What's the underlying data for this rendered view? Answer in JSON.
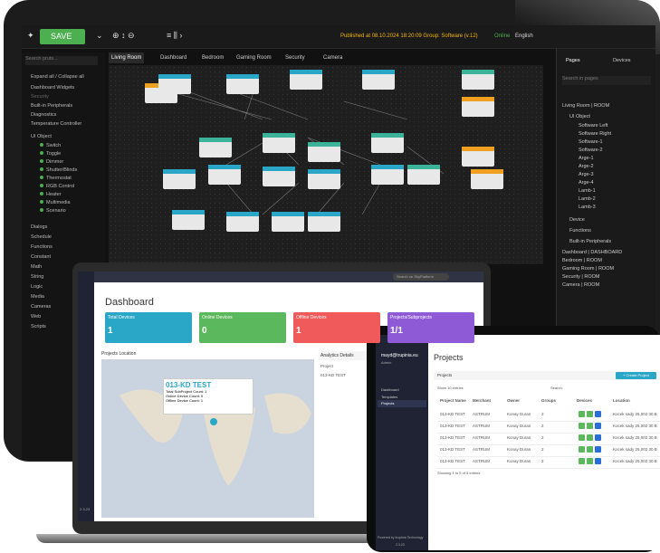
{
  "editor": {
    "save_label": "SAVE",
    "published": "Published at 08.10.2024 18:20:09",
    "group": "Group: Software (v.12)",
    "status": "Online",
    "language": "English",
    "search_placeholder": "Search pruts...",
    "tabs": [
      "Living Room",
      "Dashboard",
      "Bedroom",
      "Gaming Room",
      "Security",
      "Camera"
    ],
    "expand_label": "Expand all",
    "collapse_label": "Collapse all",
    "nav": [
      "Dashboard Widgets",
      "Security",
      "Built-in Peripherals",
      "Diagnostics",
      "Temperature Controller",
      "UI Object"
    ],
    "ui_objects": [
      "Switch",
      "Toggle",
      "Dimmer",
      "Shutter/Blinds",
      "Thermostat",
      "RGB Control",
      "Heater",
      "Multimedia",
      "Scenario"
    ],
    "nav_bottom": [
      "Dialogs",
      "Schedule",
      "Functions",
      "Constant",
      "Math",
      "String",
      "Logic",
      "Media",
      "Cameras",
      "Web",
      "Scripts"
    ],
    "right_tabs": [
      "Pages",
      "Devices"
    ],
    "right_search": "Search in pages",
    "right_tree_root": "Living Room | ROOM",
    "right_tree_ui": "UI Object",
    "right_tree_items": [
      "Software Left",
      "Software Right",
      "Software-1",
      "Software-2",
      "Arge-1",
      "Arge-2",
      "Arge-3",
      "Arge-4",
      "Lamb-1",
      "Lamb-2",
      "Lamb-3"
    ],
    "right_tree_groups": [
      "Device",
      "Functions",
      "Built-in Peripherals"
    ],
    "right_pages": [
      "Dashboard | DASHBOARD",
      "Bedroom | ROOM",
      "Gaming Room | ROOM",
      "Security | ROOM",
      "Camera | ROOM"
    ]
  },
  "laptop": {
    "title": "Dashboard",
    "search_placeholder": "Search on SkyPlatform",
    "cards": [
      {
        "label": "Total Devices",
        "value": "1",
        "color": "#2aa6c7"
      },
      {
        "label": "Online Devices",
        "value": "0",
        "color": "#5cb85c"
      },
      {
        "label": "Offline Devices",
        "value": "1",
        "color": "#f05a5a"
      },
      {
        "label": "Projects/Subprojects",
        "value": "1/1",
        "color": "#8e5ad6"
      }
    ],
    "map_title": "Projects Location",
    "analytics_title": "Analytics Details",
    "analytics_col": "Project",
    "analytics_row": "013-KD TEST",
    "popup_project": "013-KD TEST",
    "popup_lines": [
      "Total SubProject Count: 1",
      "Online Device Count: 0",
      "Offline Device Count: 1"
    ],
    "version": "2.3.23"
  },
  "tablet": {
    "user": "mayd@trupinia.eu",
    "role": "Admin",
    "page_title": "Projects",
    "panel_title": "Projects",
    "create_label": "+ Create Project",
    "show_label": "Show  10  entries",
    "search_label": "Search:",
    "columns": [
      "Project Name",
      "Merchant",
      "Owner",
      "Groups",
      "Devices",
      "Location"
    ],
    "rows": [
      [
        "013-KD TEST",
        "ASTRUM",
        "Konay Duran",
        "2",
        "",
        "Kocek sady 25,002 30 B"
      ],
      [
        "013-KD TEST",
        "ASTRUM",
        "Konay Duran",
        "2",
        "",
        "Kocek sady 25,002 30 B"
      ],
      [
        "013-KD TEST",
        "ASTRUM",
        "Konay Duran",
        "2",
        "",
        "Kocek sady 25,002 30 B"
      ],
      [
        "013-KD TEST",
        "ASTRUM",
        "Konay Duran",
        "2",
        "",
        "Kocek sady 25,002 30 B"
      ],
      [
        "013-KD TEST",
        "ASTRUM",
        "Konay Duran",
        "2",
        "",
        "Kocek sady 25,002 30 B"
      ]
    ],
    "footer": "Showing 1 to 5 of 5 entries",
    "sidebar": [
      "Dashboard",
      "Templates",
      "Projects"
    ],
    "powered": "Powered by Inopinia Technology",
    "version": "2.3.23"
  }
}
